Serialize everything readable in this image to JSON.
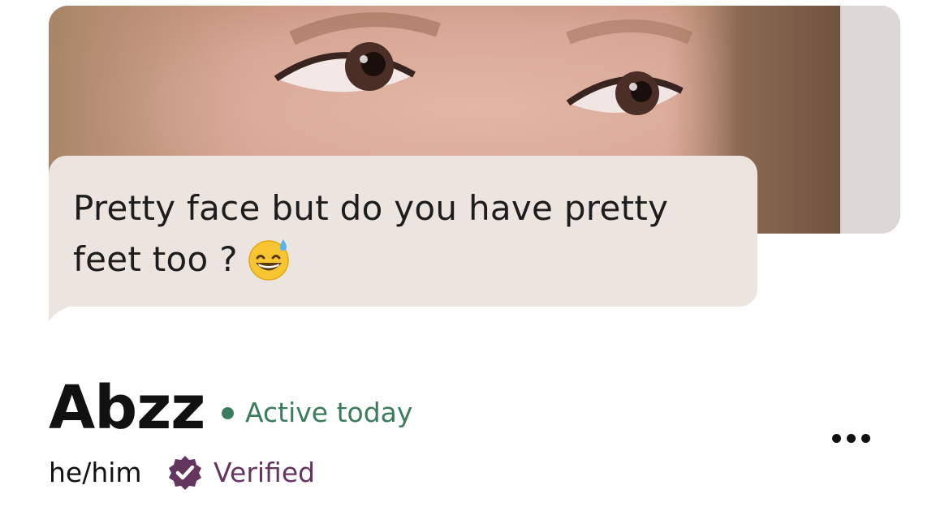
{
  "profile_photo": {
    "label": "profile photo",
    "icon": "photo"
  },
  "message": {
    "text": "Pretty face but do you have pretty feet too ?",
    "emoji_icon": "grinning-face-with-sweat-emoji",
    "bubble_color": "#ebe4df"
  },
  "profile": {
    "name": "Abzz",
    "status": "Active today",
    "status_color": "#3b7c5c",
    "pronouns": "he/him",
    "verified_label": "Verified",
    "verified_color": "#64365e",
    "verified_icon": "verified-badge-icon",
    "more_icon": "more-options-icon"
  }
}
